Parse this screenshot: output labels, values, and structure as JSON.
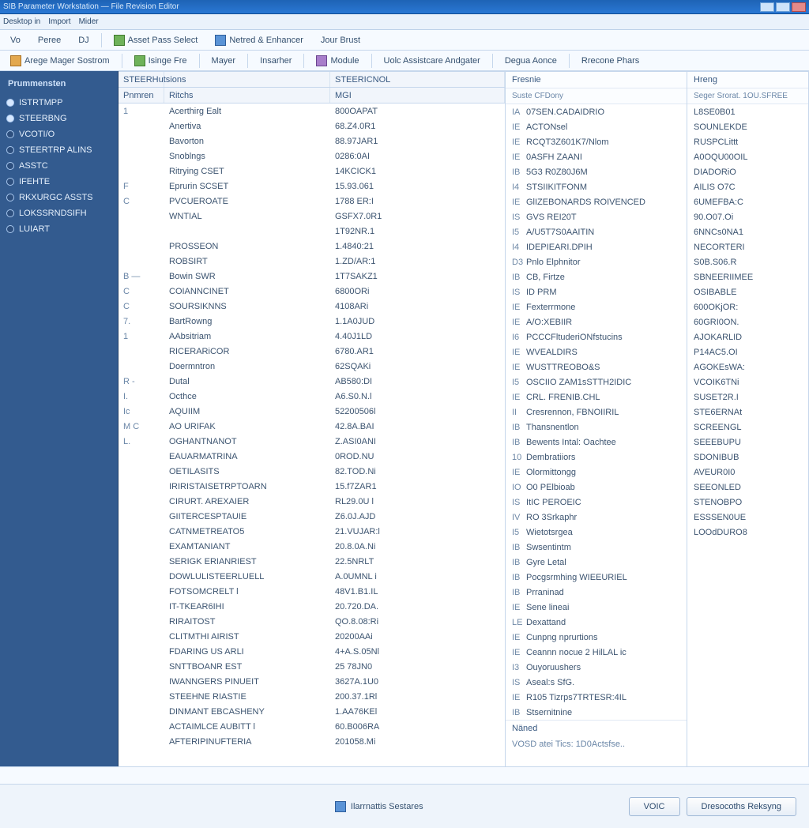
{
  "window": {
    "title": "SIB Parameter Workstation — File Revision Editor"
  },
  "menubar": [
    "Desktop in",
    "Import",
    "Mider"
  ],
  "toolbar1": {
    "a": "Vo",
    "b": "Peree",
    "c": "DJ",
    "d": "Asset Pass Select",
    "e": "Netred & Enhancer",
    "f": "Jour Brust"
  },
  "toolbar2": {
    "a": "Arege Mager Sostrom",
    "b": "Isinge Fre",
    "c": "Mayer",
    "d": "Insarher",
    "e": "Module",
    "f": "Uolc Assistcare Andgater",
    "g": "Degua Aonce",
    "h": "Rrecone Phars"
  },
  "sidebar": {
    "header": "Prummensten",
    "items": [
      "ISTRTMPP",
      "STEERBNG",
      "VCOTI/O",
      "STEERTRP  ALINS",
      "ASSTC",
      "IFEHTE",
      "RKXURGC ASSTS",
      "LOKSSRNDSIFH",
      "LUIART"
    ]
  },
  "pane1": {
    "headers": {
      "top_left": "STEERHutsions",
      "top_right": "STEERICNOL",
      "a": "Pnmren",
      "b": "Ritchs",
      "c": "MGI"
    },
    "rows": [
      {
        "k": "1",
        "n": "Acerthirg Ealt",
        "v": "800OAPAT"
      },
      {
        "k": "",
        "n": "Anertiva",
        "v": "68.Z4.0R1"
      },
      {
        "k": "",
        "n": "Bavorton",
        "v": "88.97JAR1"
      },
      {
        "k": "",
        "n": "Snoblngs",
        "v": "0286:0AI"
      },
      {
        "k": "",
        "n": "Ritrying CSET",
        "v": "14KCICK1"
      },
      {
        "k": "F",
        "n": "Eprurin SCSET",
        "v": "15.93.061"
      },
      {
        "k": "C",
        "n": "PVCUEROATE",
        "v": "1788 ER:I"
      },
      {
        "k": "",
        "n": "WNTIAL",
        "v": "GSFX7.0R1"
      },
      {
        "k": "",
        "n": "",
        "v": "1T92NR.1"
      },
      {
        "k": "",
        "n": "PROSSEON",
        "v": "1.4840:21"
      },
      {
        "k": "",
        "n": "ROBSIRT",
        "v": "1.ZD/AR:1"
      },
      {
        "k": "B —",
        "n": "Bowin SWR",
        "v": "1T7SAKZ1"
      },
      {
        "k": "C",
        "n": "COIANNCINET",
        "v": "6800ORi"
      },
      {
        "k": "C",
        "n": "SOURSIKNNS",
        "v": "4108ARi"
      },
      {
        "k": "7.",
        "n": "BartRowng",
        "v": "1.1A0JUD"
      },
      {
        "k": "1",
        "n": "AAbsitriam",
        "v": "4.40J1LD"
      },
      {
        "k": "",
        "n": "RICERARiCOR",
        "v": "6780.AR1"
      },
      {
        "k": "",
        "n": "Doermntron",
        "v": "62SQAKi"
      },
      {
        "k": "R -",
        "n": "Dutal",
        "v": "AB580:DI"
      },
      {
        "k": "I.",
        "n": "Octhce",
        "v": "A6.S0.N.l"
      },
      {
        "k": "Ic",
        "n": "AQUIIM",
        "v": "52200506l"
      },
      {
        "k": "M  C",
        "n": "AO URIFAK",
        "v": "42.8A.BAI"
      },
      {
        "k": "L.",
        "n": "OGHANTNANOT",
        "v": "Z.ASI0ANI"
      },
      {
        "k": "",
        "n": "EAUARMATRINA",
        "v": "0ROD.NU"
      },
      {
        "k": "",
        "n": "OETILASITS",
        "v": "82.TOD.Ni"
      },
      {
        "k": "",
        "n": "IRIRISTAISETRPTOARN",
        "v": "15.f7ZAR1"
      },
      {
        "k": "",
        "n": "CIRURT. AREXAIER",
        "v": "RL29.0U l"
      },
      {
        "k": "",
        "n": "GIITERCESPTAUIE",
        "v": "Z6.0J.AJD"
      },
      {
        "k": "",
        "n": "CATNMETREATO5",
        "v": "21.VUJAR:l"
      },
      {
        "k": "",
        "n": "EXAMTANIANT",
        "v": "20.8.0A.Ni"
      },
      {
        "k": "",
        "n": "SERIGK ERIANRIEST",
        "v": "22.5NRLT"
      },
      {
        "k": "",
        "n": "DOWLULISTEERLUELL",
        "v": "A.0UMNL i"
      },
      {
        "k": "",
        "n": "FOTSOMCRELT l",
        "v": "48V1.B1.IL"
      },
      {
        "k": "",
        "n": "IT-TKEAR6IHI",
        "v": "20.720.DA."
      },
      {
        "k": "",
        "n": "RIRAITOST",
        "v": "QO.8.08:Ri"
      },
      {
        "k": "",
        "n": "CLITMTHI AIRIST",
        "v": "20200AAi"
      },
      {
        "k": "",
        "n": "FDARING US ARLI",
        "v": "4+A.S.05Nl"
      },
      {
        "k": "",
        "n": "SNTTBOANR EST",
        "v": "25 78JN0"
      },
      {
        "k": "",
        "n": "IWANNGERS PINUEIT",
        "v": "3627A.1U0"
      },
      {
        "k": "",
        "n": "STEEHNE RIASTIE",
        "v": "200.37.1Rl"
      },
      {
        "k": "",
        "n": "DINMANT EBCASHENY",
        "v": "1.AA76KEl"
      },
      {
        "k": "",
        "n": "ACTAIMLCE AUBITT l",
        "v": "60.B006RA"
      },
      {
        "k": "",
        "n": "AFTERIPINUFTERIA",
        "v": "201058.Mi"
      }
    ]
  },
  "pane2": {
    "header": "Fresnie",
    "subheader": "Suste CFDony",
    "rows": [
      {
        "k": "IA",
        "v": "07SEN.CADAIDRIO"
      },
      {
        "k": "IE",
        "v": "ACTONsel"
      },
      {
        "k": "IE",
        "v": "RCQT3Z601K7/Nlom"
      },
      {
        "k": "IE",
        "v": "0ASFH ZAANI"
      },
      {
        "k": "IB",
        "v": "5G3 R0Z80J6M"
      },
      {
        "k": "I4",
        "v": "STSIIKITFONM"
      },
      {
        "k": "IE",
        "v": "GlIZEBONARDS ROIVENCED"
      },
      {
        "k": "IS",
        "v": "GVS REI20T"
      },
      {
        "k": "I5",
        "v": "A/U5T7S0AAITIN"
      },
      {
        "k": "I4",
        "v": "IDEPIEARI.DPIH"
      },
      {
        "k": "D3",
        "v": "Pnlo Elphnitor"
      },
      {
        "k": "IB",
        "v": "CB, Firtze"
      },
      {
        "k": "IS",
        "v": "ID  PRM"
      },
      {
        "k": "IE",
        "v": "Fexterrmone"
      },
      {
        "k": "IE",
        "v": "A/O:XEBIIR"
      },
      {
        "k": "I6",
        "v": "PCCCFltuderiONfstucins"
      },
      {
        "k": "IE",
        "v": "WVEALDIRS"
      },
      {
        "k": "IE",
        "v": "WUSTTREOBO&S"
      },
      {
        "k": "I5",
        "v": "OSCIIO ZAM1sSTTH2IDIC"
      },
      {
        "k": "IE",
        "v": "CRL. FRENIB.CHL"
      },
      {
        "k": "II",
        "v": "Cresrennon, FBNOIIRIL"
      },
      {
        "k": "IB",
        "v": "Thansnentlon"
      },
      {
        "k": "IB",
        "v": "Bewents Intal:  Oachtee"
      },
      {
        "k": "10",
        "v": "Dembratiiors"
      },
      {
        "k": "IE",
        "v": "Olormittongg"
      },
      {
        "k": "IO",
        "v": "O0  PElbioab"
      },
      {
        "k": "IS",
        "v": "ItIC PEROEIC"
      },
      {
        "k": "IV",
        "v": "RO   3Srkaphr"
      },
      {
        "k": "I5",
        "v": "Wietotsrgea"
      },
      {
        "k": "IB",
        "v": "Swsentintm"
      },
      {
        "k": "IB",
        "v": "Gyre Letal"
      },
      {
        "k": "IB",
        "v": "Pocgsrmhing WIEEURIEL"
      },
      {
        "k": "IB",
        "v": "Prraninad"
      },
      {
        "k": "IE",
        "v": "Sene lineai"
      },
      {
        "k": "LE",
        "v": "Dexattand"
      },
      {
        "k": "IE",
        "v": "Cunpng nprurtions"
      },
      {
        "k": "IE",
        "v": "Ceannn nocue 2 HilLAL ic"
      },
      {
        "k": "I3",
        "v": "Ouyoruushers"
      },
      {
        "k": "IS",
        "v": "Aseal:s SfG."
      },
      {
        "k": "IE",
        "v": "R105 Tizrps7TRTESR:4IL"
      },
      {
        "k": "IB",
        "v": "Stsernitnine"
      }
    ],
    "footlabel": "Näned",
    "footvalue": "VOSD atei  Tics:  1D0Actsfse.."
  },
  "pane3": {
    "header": "Hreng",
    "subheader": "Seger Srorat.  1OU.SFREE",
    "rows": [
      "L8SE0B01",
      "SOUNLEKDE",
      "RUSPCLittt",
      "A0OQU00OIL",
      "DIADORiO",
      "AILIS O7C",
      "6UMEFBA:C",
      "90.O07.Oi",
      "6NNCs0NA1",
      "NECORTERI",
      "S0B.S06.R",
      "SBNEERIIMEE",
      "OSIBABLE",
      "600OKjOR:",
      "60GRI0ON.",
      "AJOKARLID",
      "P14AC5.OI",
      "AGOKEsWA:",
      "VCOIK6TNi",
      "SUSET2R.I",
      "STE6ERNAt",
      "SCREENGL",
      "SEEEBUPU",
      "SDONIBUB",
      "AVEUR0I0",
      "SEEONLED",
      "STENOBPO",
      "ESSSEN0UE",
      "LOOdDURO8"
    ]
  },
  "footer": {
    "status": "Ilarrnattis Sestares",
    "ok": "VOIC",
    "cancel": "Dresocoths Reksyng"
  }
}
